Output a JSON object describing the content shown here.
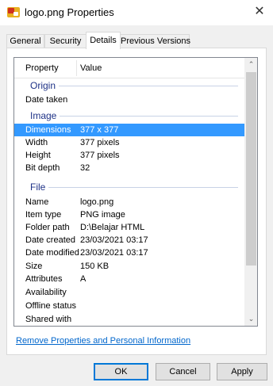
{
  "window": {
    "title": "logo.png Properties",
    "close_glyph": "✕"
  },
  "tabs": [
    {
      "label": "General",
      "active": false
    },
    {
      "label": "Security",
      "active": false
    },
    {
      "label": "Details",
      "active": true
    },
    {
      "label": "Previous Versions",
      "active": false
    }
  ],
  "list": {
    "headers": {
      "property": "Property",
      "value": "Value"
    },
    "groups": {
      "origin": "Origin",
      "image": "Image",
      "file": "File"
    },
    "rows": {
      "date_taken": {
        "property": "Date taken",
        "value": ""
      },
      "dimensions": {
        "property": "Dimensions",
        "value": "377 x 377"
      },
      "width": {
        "property": "Width",
        "value": "377 pixels"
      },
      "height": {
        "property": "Height",
        "value": "377 pixels"
      },
      "bit_depth": {
        "property": "Bit depth",
        "value": "32"
      },
      "name": {
        "property": "Name",
        "value": "logo.png"
      },
      "item_type": {
        "property": "Item type",
        "value": "PNG image"
      },
      "folder_path": {
        "property": "Folder path",
        "value": "D:\\Belajar HTML"
      },
      "date_created": {
        "property": "Date created",
        "value": "23/03/2021 03:17"
      },
      "date_modified": {
        "property": "Date modified",
        "value": "23/03/2021 03:17"
      },
      "size": {
        "property": "Size",
        "value": "150 KB"
      },
      "attributes": {
        "property": "Attributes",
        "value": "A"
      },
      "availability": {
        "property": "Availability",
        "value": ""
      },
      "offline_status": {
        "property": "Offline status",
        "value": ""
      },
      "shared_with": {
        "property": "Shared with",
        "value": ""
      }
    },
    "scroll_up_glyph": "⌃",
    "scroll_down_glyph": "⌄"
  },
  "remove_link": "Remove Properties and Personal Information",
  "buttons": {
    "ok": "OK",
    "cancel": "Cancel",
    "apply": "Apply"
  },
  "colors": {
    "selection": "#3399ff",
    "group_text": "#1e3287",
    "link": "#0066cc",
    "default_button_border": "#0078d7"
  }
}
